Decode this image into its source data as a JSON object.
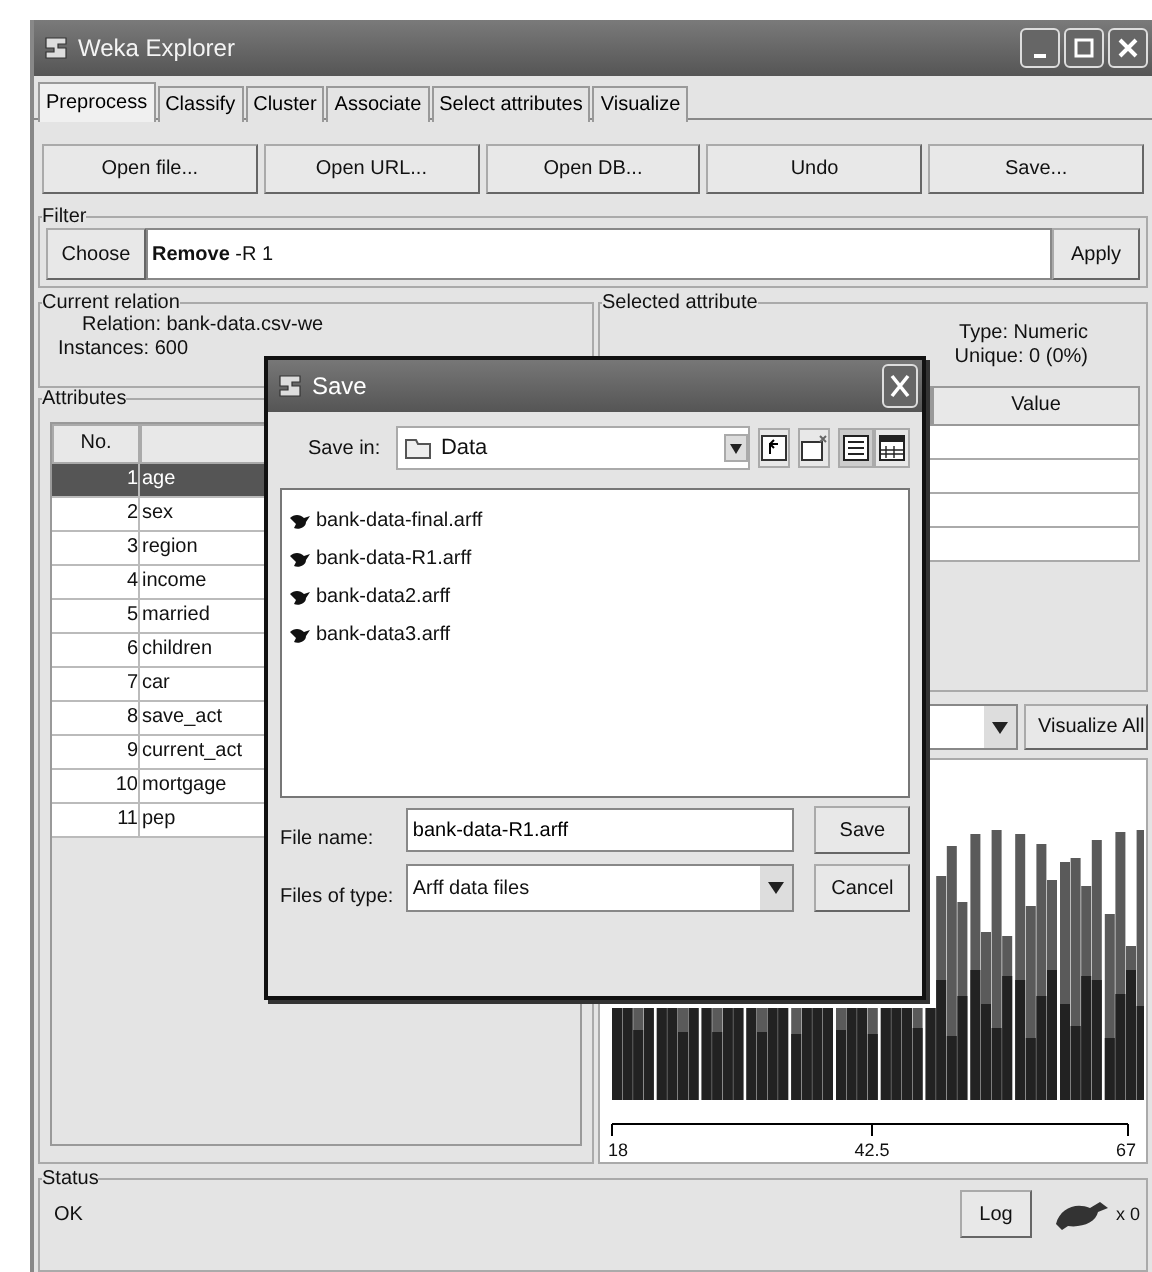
{
  "window": {
    "title": "Weka Explorer"
  },
  "tabs": [
    {
      "label": "Preprocess",
      "selected": true
    },
    {
      "label": "Classify",
      "selected": false
    },
    {
      "label": "Cluster",
      "selected": false
    },
    {
      "label": "Associate",
      "selected": false
    },
    {
      "label": "Select attributes",
      "selected": false
    },
    {
      "label": "Visualize",
      "selected": false
    }
  ],
  "toolbar_buttons": [
    "Open file...",
    "Open URL...",
    "Open DB...",
    "Undo",
    "Save..."
  ],
  "filter": {
    "title": "Filter",
    "choose_button": "Choose",
    "value": "**Remove** -R 1",
    "apply_button": "Apply"
  },
  "current_relation": {
    "title": "Current relation",
    "relation": "Relation: bank-data.csv-we",
    "instances": "Instances: 600"
  },
  "attributes": {
    "title": "Attributes",
    "columns": [
      "No."
    ],
    "rows": [
      {
        "no": "1",
        "name": "age",
        "selected": true
      },
      {
        "no": "2",
        "name": "sex",
        "selected": false
      },
      {
        "no": "3",
        "name": "region",
        "selected": false
      },
      {
        "no": "4",
        "name": "income",
        "selected": false
      },
      {
        "no": "5",
        "name": "married",
        "selected": false
      },
      {
        "no": "6",
        "name": "children",
        "selected": false
      },
      {
        "no": "7",
        "name": "car",
        "selected": false
      },
      {
        "no": "8",
        "name": "save_act",
        "selected": false
      },
      {
        "no": "9",
        "name": "current_act",
        "selected": false
      },
      {
        "no": "10",
        "name": "mortgage",
        "selected": false
      },
      {
        "no": "11",
        "name": "pep",
        "selected": false
      }
    ]
  },
  "selected_attribute": {
    "title": "Selected attribute",
    "type": "Type: Numeric",
    "unique": "Unique: 0 (0%)",
    "value_column": "Value",
    "visualize_all_button": "Visualize All",
    "axis_labels": [
      "18",
      "42.5",
      "67"
    ]
  },
  "status": {
    "title": "Status",
    "text": "OK",
    "log_button": "Log",
    "count": "x 0"
  },
  "save_dialog": {
    "title": "Save",
    "save_in_label": "Save in:",
    "save_in_value": "Data",
    "files": [
      "bank-data-final.arff",
      "bank-data-R1.arff",
      "bank-data2.arff",
      "bank-data3.arff"
    ],
    "file_name_label": "File name:",
    "file_name": "bank-data-R1.arff",
    "file_type_label": "Files of type:",
    "file_type": "Arff data files",
    "save_button": "Save",
    "cancel_button": "Cancel"
  }
}
